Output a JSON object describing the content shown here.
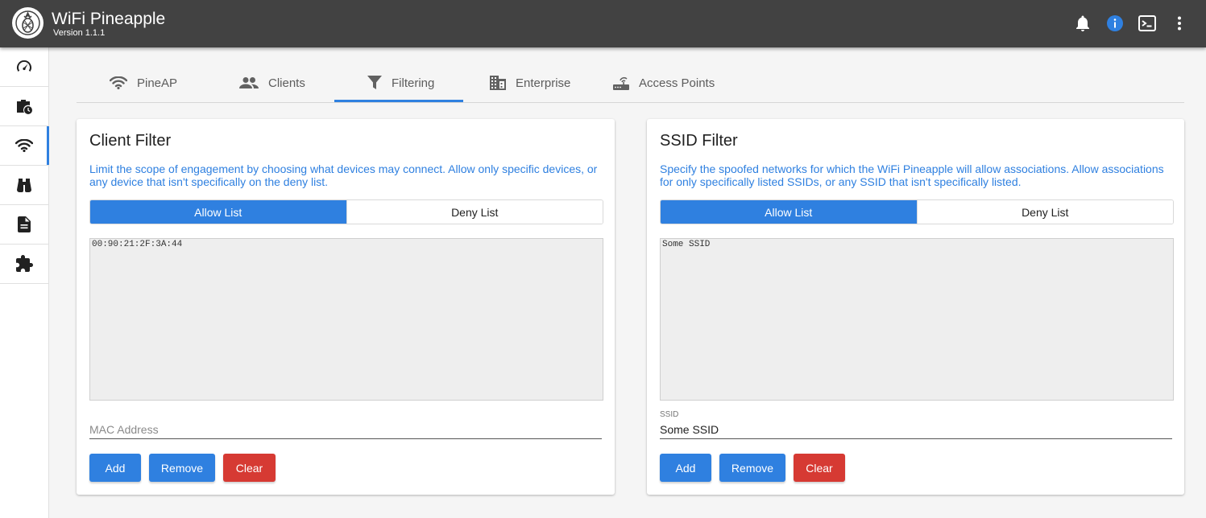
{
  "app": {
    "title": "WiFi Pineapple",
    "version": "Version 1.1.1"
  },
  "header_icons": [
    "notifications-icon",
    "info-icon",
    "terminal-icon",
    "more-vert-icon"
  ],
  "sidebar": {
    "items": [
      {
        "icon": "dashboard-icon",
        "active": false
      },
      {
        "icon": "campaigns-icon",
        "active": false
      },
      {
        "icon": "wifi-icon",
        "active": true
      },
      {
        "icon": "recon-binoculars-icon",
        "active": false
      },
      {
        "icon": "logs-icon",
        "active": false
      },
      {
        "icon": "modules-puzzle-icon",
        "active": false
      }
    ]
  },
  "tabs": [
    {
      "label": "PineAP",
      "icon": "wifi-icon"
    },
    {
      "label": "Clients",
      "icon": "people-icon"
    },
    {
      "label": "Filtering",
      "icon": "filter-icon",
      "active": true
    },
    {
      "label": "Enterprise",
      "icon": "building-icon"
    },
    {
      "label": "Access Points",
      "icon": "router-icon"
    }
  ],
  "client_filter": {
    "title": "Client Filter",
    "description": "Limit the scope of engagement by choosing what devices may connect. Allow only specific devices, or any device that isn't specifically on the deny list.",
    "allow_label": "Allow List",
    "deny_label": "Deny List",
    "list_text": "00:90:21:2F:3A:44",
    "input_placeholder": "MAC Address",
    "input_value": "",
    "add_label": "Add",
    "remove_label": "Remove",
    "clear_label": "Clear"
  },
  "ssid_filter": {
    "title": "SSID Filter",
    "description": "Specify the spoofed networks for which the WiFi Pineapple will allow associations. Allow associations for only specifically listed SSIDs, or any SSID that isn't specifically listed.",
    "allow_label": "Allow List",
    "deny_label": "Deny List",
    "list_text": "Some SSID",
    "input_label": "SSID",
    "input_value": "Some SSID",
    "add_label": "Add",
    "remove_label": "Remove",
    "clear_label": "Clear"
  },
  "colors": {
    "header": "#424242",
    "accent": "#2f80e0",
    "danger": "#d63a33",
    "info_icon": "#2f80e0"
  }
}
